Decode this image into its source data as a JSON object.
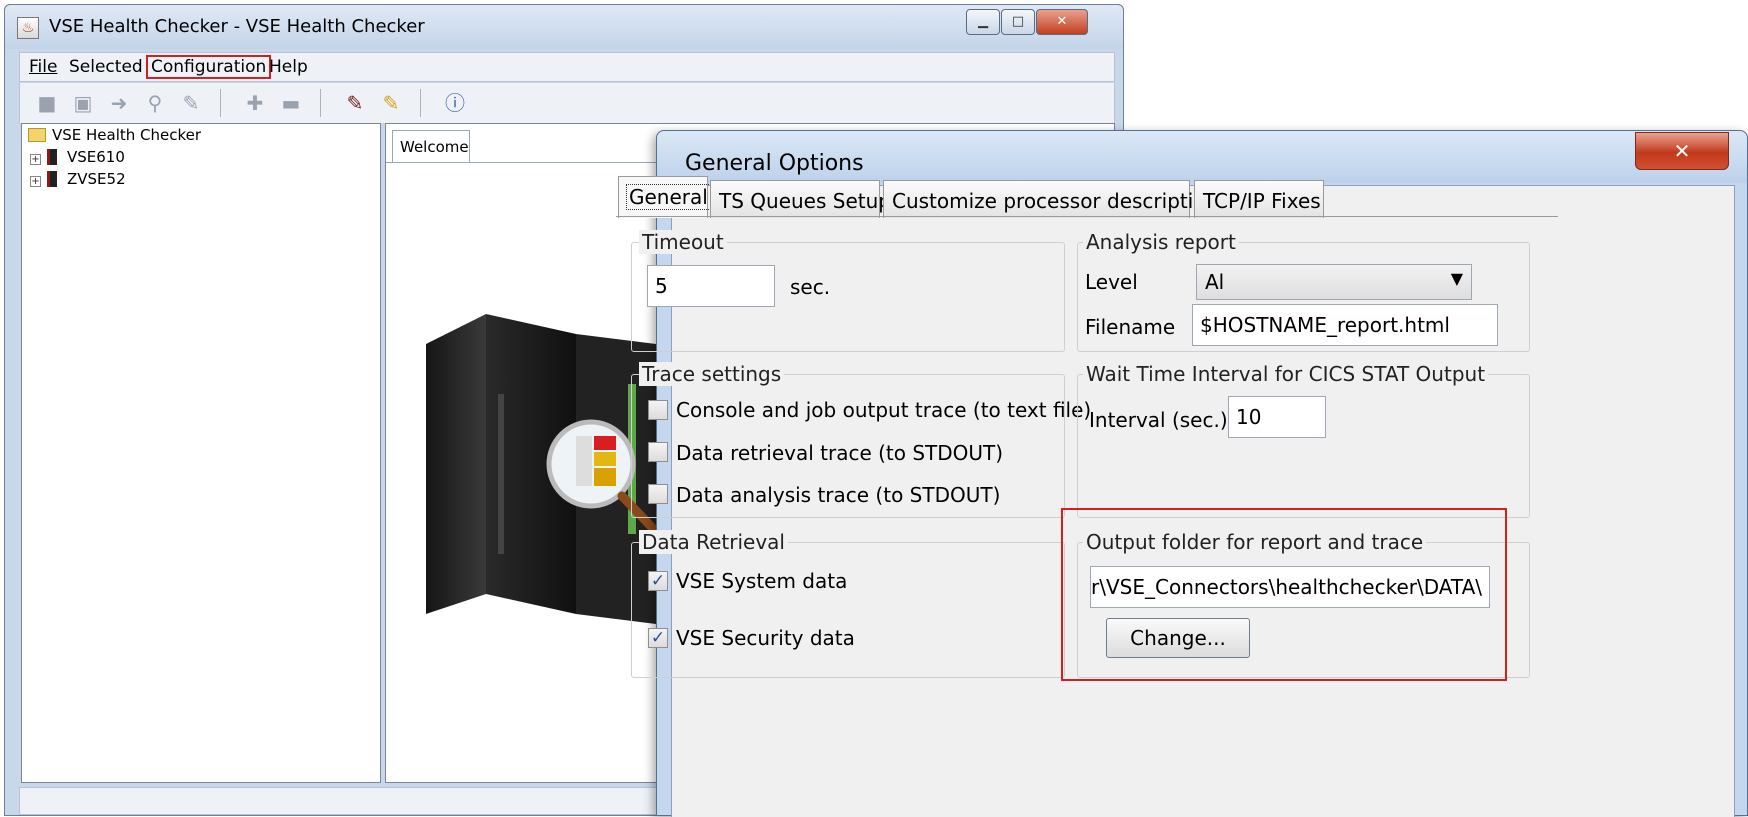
{
  "main_window": {
    "title": "VSE Health Checker - VSE Health Checker",
    "menu": {
      "file": "File",
      "selected": "Selected",
      "configuration": "Configuration",
      "help": "Help"
    },
    "toolbar_icons": [
      "open-folder-icon",
      "save-icon",
      "go-arrow-icon",
      "search-icon",
      "edit-icon",
      "plus-icon",
      "minus-icon",
      "edit-config-icon",
      "edit-note-icon",
      "help-icon"
    ],
    "tree": {
      "root": "VSE Health Checker",
      "systems": [
        "VSE610",
        "ZVSE52"
      ]
    },
    "content_tab": "Welcome"
  },
  "dialog": {
    "title": "General Options",
    "tabs": [
      "General",
      "TS Queues Setup",
      "Customize processor descriptions",
      "TCP/IP Fixes"
    ],
    "active_tab": "General",
    "timeout": {
      "title": "Timeout",
      "value": "5",
      "unit": "sec."
    },
    "analysis_report": {
      "title": "Analysis report",
      "level_label": "Level",
      "level_value": "Al",
      "filename_label": "Filename",
      "filename_value": "$HOSTNAME_report.html"
    },
    "trace_settings": {
      "title": "Trace settings",
      "options": [
        {
          "label": "Console and job output trace (to text file)",
          "checked": false
        },
        {
          "label": "Data retrieval trace (to STDOUT)",
          "checked": false
        },
        {
          "label": "Data analysis trace (to STDOUT)",
          "checked": false
        }
      ]
    },
    "wait_time": {
      "title": "Wait Time Interval for CICS STAT Output",
      "interval_label": "Interval (sec.)",
      "interval_value": "10"
    },
    "data_retrieval": {
      "title": "Data Retrieval",
      "options": [
        {
          "label": "VSE System data",
          "checked": true
        },
        {
          "label": "VSE Security data",
          "checked": true
        }
      ]
    },
    "output_folder": {
      "title": "Output folder for report and trace",
      "path": "\\ser\\VSE_Connectors\\healthchecker\\DATA\\",
      "change_label": "Change..."
    }
  },
  "colors": {
    "highlight": "#d21f1f",
    "window_frame": "#c4d7ee",
    "dialog_body": "#f0f0f0"
  }
}
